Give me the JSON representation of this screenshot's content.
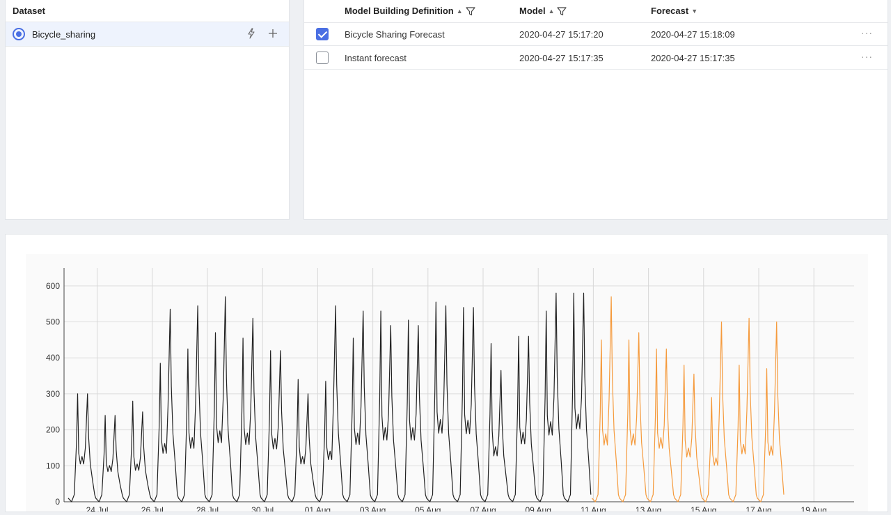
{
  "dataset_panel": {
    "header": "Dataset",
    "items": [
      {
        "label": "Bicycle_sharing",
        "selected": true,
        "icons": [
          "lightning-icon",
          "plus-icon"
        ]
      }
    ]
  },
  "models_panel": {
    "columns": [
      {
        "label": "Model Building Definition",
        "sortable": true,
        "filterable": true
      },
      {
        "label": "Model",
        "sortable": true,
        "filterable": true
      },
      {
        "label": "Forecast",
        "sortable": true,
        "filterable": false
      }
    ],
    "rows": [
      {
        "checked": true,
        "definition": "Bicycle Sharing Forecast",
        "model": "2020-04-27 15:17:20",
        "forecast": "2020-04-27 15:18:09",
        "more": "···"
      },
      {
        "checked": false,
        "definition": "Instant forecast",
        "model": "2020-04-27 15:17:35",
        "forecast": "2020-04-27 15:17:35",
        "more": "···"
      }
    ]
  },
  "chart_data": {
    "type": "line",
    "title": "",
    "xlabel": "",
    "ylabel": "",
    "ylim": [
      0,
      650
    ],
    "yticks": [
      0,
      100,
      200,
      300,
      400,
      500,
      600
    ],
    "xticks": [
      "24 Jul",
      "26 Jul",
      "28 Jul",
      "30 Jul",
      "01 Aug",
      "03 Aug",
      "05 Aug",
      "07 Aug",
      "09 Aug",
      "11 Aug",
      "13 Aug",
      "15 Aug",
      "17 Aug",
      "19 Aug"
    ],
    "grid": true,
    "colors": {
      "actual": "#222222",
      "forecast": "#f59a3c"
    },
    "series": [
      {
        "key": "actual",
        "x": [
          "23 Jul",
          "24 Jul",
          "25 Jul",
          "26 Jul",
          "27 Jul",
          "28 Jul",
          "29 Jul",
          "30 Jul",
          "31 Jul",
          "01 Aug",
          "02 Aug",
          "03 Aug",
          "04 Aug",
          "05 Aug",
          "06 Aug",
          "07 Aug",
          "08 Aug",
          "09 Aug",
          "10 Aug"
        ],
        "peak_am": [
          300,
          240,
          280,
          385,
          425,
          470,
          455,
          420,
          340,
          335,
          455,
          530,
          505,
          555,
          540,
          440,
          460,
          530,
          580
        ],
        "peak_pm": [
          300,
          240,
          250,
          535,
          545,
          570,
          510,
          420,
          300,
          545,
          530,
          490,
          490,
          545,
          540,
          365,
          460,
          580,
          580
        ],
        "low": [
          0,
          0,
          0,
          0,
          0,
          0,
          0,
          0,
          0,
          0,
          0,
          0,
          0,
          0,
          0,
          0,
          0,
          0,
          0
        ]
      },
      {
        "key": "forecast",
        "x": [
          "11 Aug",
          "12 Aug",
          "13 Aug",
          "14 Aug",
          "15 Aug",
          "16 Aug",
          "17 Aug"
        ],
        "peak_am": [
          450,
          450,
          425,
          380,
          290,
          380,
          370
        ],
        "peak_pm": [
          570,
          470,
          425,
          355,
          500,
          510,
          500
        ],
        "low": [
          0,
          0,
          0,
          0,
          0,
          0,
          0
        ]
      }
    ]
  }
}
